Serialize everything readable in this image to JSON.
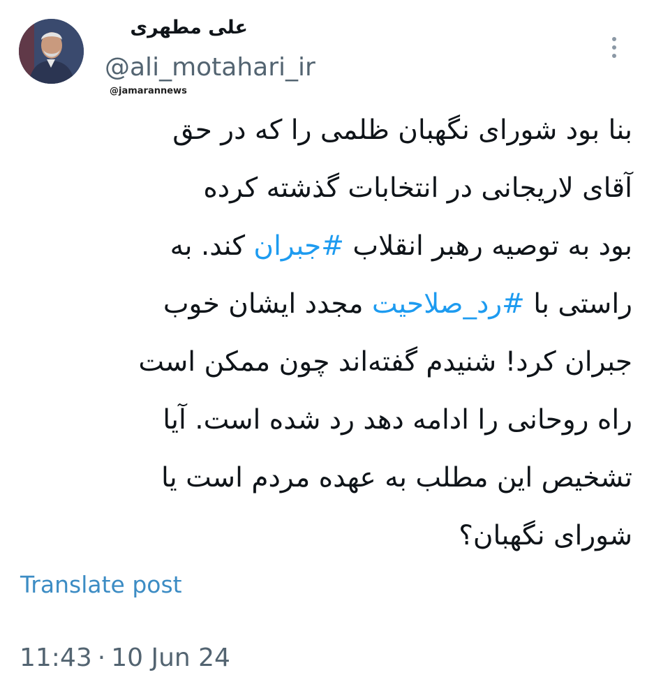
{
  "author": {
    "display_name": "علی مطهری",
    "handle": "@ali_motahari_ir",
    "avatar_icon": "user-portrait"
  },
  "watermark": "@jamarannews",
  "menu": {
    "icon": "more-vertical-icon"
  },
  "tweet": {
    "lines": [
      [
        "بنا بود شورای نگهبان ظلمی را که در حق"
      ],
      [
        "آقای لاریجانی در انتخابات گذشته کرده"
      ],
      [
        "بود به توصیه رهبر انقلاب ",
        "#جبران",
        " کند. به"
      ],
      [
        "راستی با ",
        "#رد_صلاحیت",
        " مجدد ایشان خوب"
      ],
      [
        "جبران کرد! شنیدم گفته‌اند چون ممکن است"
      ],
      [
        "راه روحانی را ادامه دهد رد شده است. آیا"
      ],
      [
        "تشخیص این مطلب به عهده مردم است یا"
      ],
      [
        "شورای نگهبان؟"
      ]
    ],
    "hashtags": [
      "#جبران",
      "#رد_صلاحیت"
    ]
  },
  "translate_label": "Translate post",
  "meta": {
    "time": "11:43",
    "separator": "·",
    "date": "10 Jun 24"
  },
  "colors": {
    "link": "#1d9bf0",
    "translate": "#3c8cc4",
    "secondary_text": "#536471",
    "primary_text": "#0f1419"
  }
}
